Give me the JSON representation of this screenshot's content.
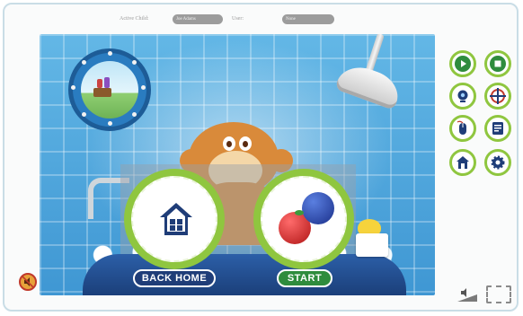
{
  "header": {
    "active_child_label": "Active Child:",
    "active_child_value": "Joe Adams",
    "user_label": "User:",
    "user_value": "None"
  },
  "game": {
    "back_home_label": "BACK HOME",
    "start_label": "START"
  },
  "side_toolbar": {
    "buttons": [
      {
        "name": "play",
        "icon": "play-icon"
      },
      {
        "name": "stop",
        "icon": "stop-icon"
      },
      {
        "name": "webcam",
        "icon": "webcam-icon"
      },
      {
        "name": "target",
        "icon": "target-icon"
      },
      {
        "name": "mouse",
        "icon": "mouse-icon"
      },
      {
        "name": "notes",
        "icon": "notes-icon"
      },
      {
        "name": "home",
        "icon": "home-icon"
      },
      {
        "name": "settings",
        "icon": "gear-icon"
      }
    ]
  },
  "colors": {
    "accent_green": "#8fc63f",
    "navy": "#1f3d78",
    "start_green": "#2f8c3d",
    "tile_blue": "#4fa8de"
  }
}
